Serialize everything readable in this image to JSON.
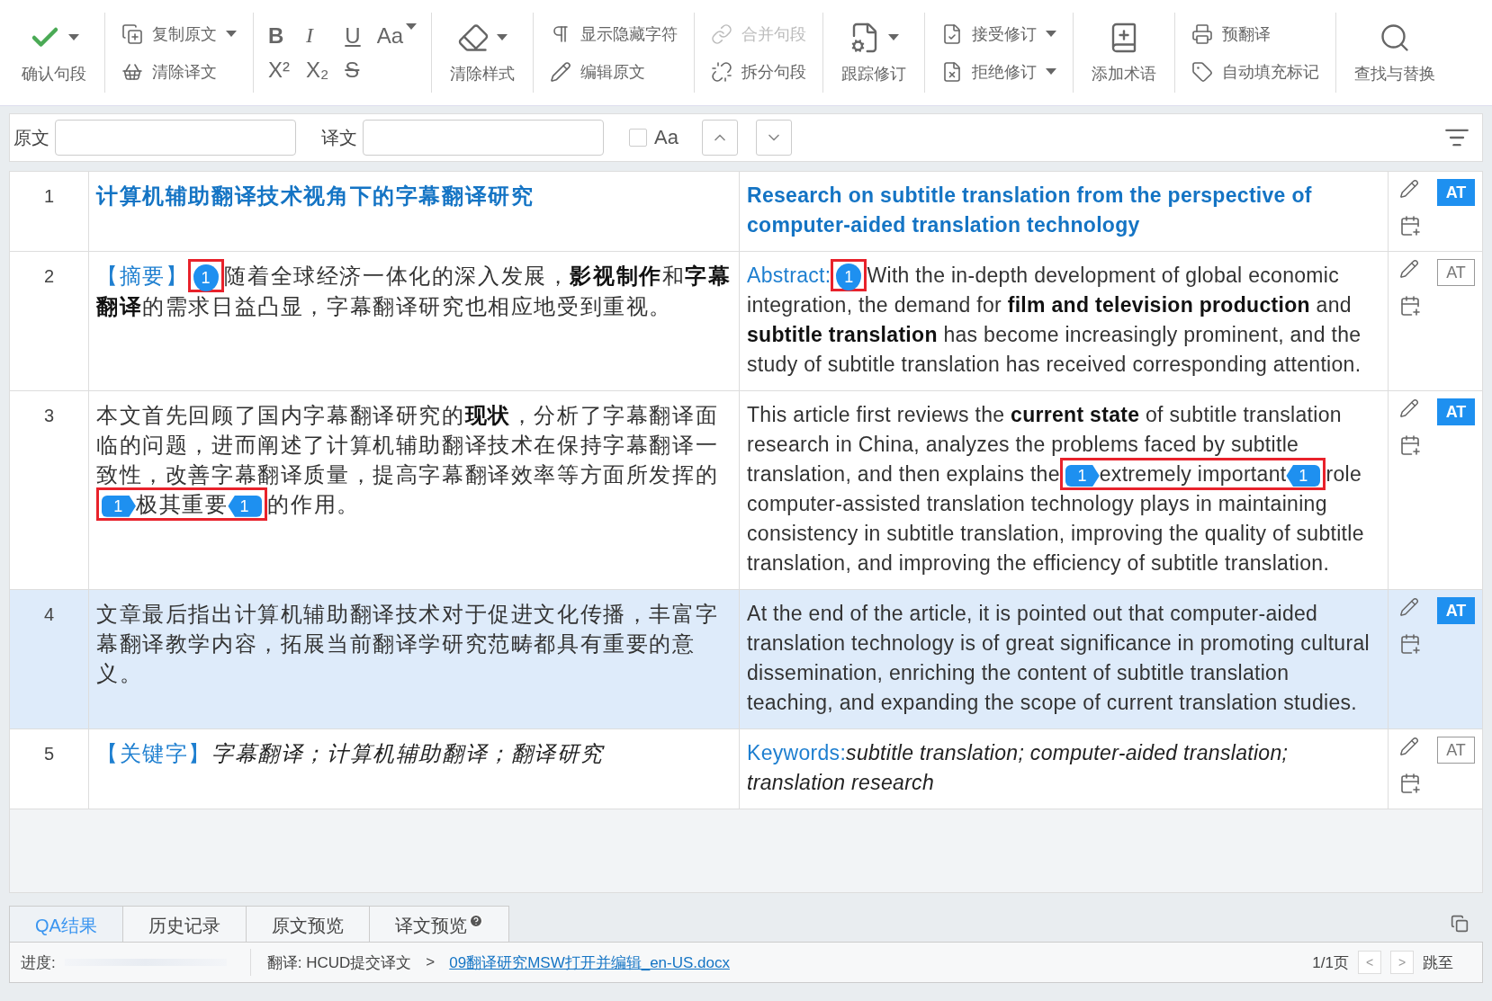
{
  "toolbar": {
    "groups": [
      {
        "kind": "large",
        "items": [
          {
            "label": "确认句段",
            "caret": true,
            "disabled": false
          }
        ]
      },
      {
        "kind": "stack",
        "items": [
          {
            "label": "复制原文",
            "caret": true,
            "disabled": false
          },
          {
            "label": "清除译文",
            "caret": false,
            "disabled": false
          }
        ]
      },
      {
        "kind": "format",
        "items": [
          {
            "kind": "bold",
            "glyph": "B",
            "caret": false
          },
          {
            "kind": "italic",
            "glyph": "I",
            "caret": false
          },
          {
            "kind": "underline",
            "glyph": "U",
            "caret": false
          },
          {
            "kind": "case",
            "glyph": "Aa",
            "caret": true
          },
          {
            "kind": "plain",
            "glyph": "X²",
            "caret": false
          },
          {
            "kind": "plain",
            "glyph": "X₂",
            "caret": false
          },
          {
            "kind": "strike",
            "glyph": "S",
            "caret": false
          }
        ]
      },
      {
        "kind": "large",
        "items": [
          {
            "label": "清除样式",
            "caret": true,
            "disabled": false
          }
        ]
      },
      {
        "kind": "stack",
        "items": [
          {
            "label": "显示隐藏字符",
            "caret": false,
            "disabled": false
          },
          {
            "label": "编辑原文",
            "caret": false,
            "disabled": false
          }
        ]
      },
      {
        "kind": "stack",
        "items": [
          {
            "label": "合并句段",
            "caret": false,
            "disabled": true
          },
          {
            "label": "拆分句段",
            "caret": false,
            "disabled": false
          }
        ]
      },
      {
        "kind": "large",
        "items": [
          {
            "label": "跟踪修订",
            "caret": true,
            "disabled": false
          }
        ]
      },
      {
        "kind": "stack",
        "items": [
          {
            "label": "接受修订",
            "caret": true,
            "disabled": false
          },
          {
            "label": "拒绝修订",
            "caret": true,
            "disabled": false
          }
        ]
      },
      {
        "kind": "large",
        "items": [
          {
            "label": "添加术语",
            "caret": false,
            "disabled": false
          }
        ]
      },
      {
        "kind": "stack",
        "items": [
          {
            "label": "预翻译",
            "caret": false,
            "disabled": false
          },
          {
            "label": "自动填充标记",
            "caret": false,
            "disabled": false
          }
        ]
      },
      {
        "kind": "large",
        "items": [
          {
            "label": "查找与替换",
            "caret": false,
            "disabled": false
          }
        ]
      }
    ]
  },
  "filter": {
    "source_label": "原文",
    "target_label": "译文",
    "case_label": "Aa",
    "case_checked": false
  },
  "segments": [
    {
      "number": "1",
      "selected": false,
      "at_on": true,
      "at_label": "AT",
      "source": [
        {
          "kind": "title",
          "text": "计算机辅助翻译技术视角下的字幕翻译研究"
        }
      ],
      "target": [
        {
          "kind": "title",
          "text": "Research on subtitle translation from the perspective of computer-aided translation technology"
        }
      ]
    },
    {
      "number": "2",
      "selected": false,
      "at_on": false,
      "at_label": "AT",
      "source": [
        {
          "kind": "label",
          "text": "【摘要】"
        },
        {
          "kind": "mark",
          "parts": [
            {
              "kind": "tag_single",
              "text": "1"
            }
          ]
        },
        {
          "kind": "text",
          "text": "随着全球经济一体化的深入发展，**影视制作**和**字幕翻译**的需求日益凸显，字幕翻译研究也相应地受到重视。"
        }
      ],
      "target": [
        {
          "kind": "label",
          "text": "Abstract:"
        },
        {
          "kind": "mark",
          "parts": [
            {
              "kind": "tag_single",
              "text": "1"
            }
          ]
        },
        {
          "kind": "text",
          "text": "With the in-depth development of global economic integration, the demand for **film and television production** and **subtitle translation** has become increasingly prominent, and the study of subtitle translation has received corresponding attention."
        }
      ]
    },
    {
      "number": "3",
      "selected": false,
      "at_on": true,
      "at_label": "AT",
      "source": [
        {
          "kind": "text",
          "text": "本文首先回顾了国内字幕翻译研究的**现状**，分析了字幕翻译面临的问题，进而阐述了计算机辅助翻译技术在保持字幕翻译一致性，改善字幕翻译质量，提高字幕翻译效率等方面所发挥的"
        },
        {
          "kind": "mark",
          "parts": [
            {
              "kind": "tag_open",
              "text": "1"
            },
            {
              "kind": "text",
              "text": "极其重要"
            },
            {
              "kind": "tag_close",
              "text": "1"
            }
          ]
        },
        {
          "kind": "text",
          "text": "的作用。"
        }
      ],
      "target": [
        {
          "kind": "text",
          "text": "This article first reviews the **current state** of subtitle translation research in China, analyzes the problems faced by subtitle translation, and then explains the"
        },
        {
          "kind": "mark",
          "parts": [
            {
              "kind": "tag_open",
              "text": "1"
            },
            {
              "kind": "text",
              "text": "extremely important"
            },
            {
              "kind": "tag_close",
              "text": "1"
            }
          ]
        },
        {
          "kind": "text",
          "text": "role computer-assisted translation technology plays in maintaining consistency in subtitle translation, improving the quality of subtitle translation, and improving the efficiency of subtitle translation."
        }
      ]
    },
    {
      "number": "4",
      "selected": true,
      "at_on": true,
      "at_label": "AT",
      "source": [
        {
          "kind": "text",
          "text": "文章最后指出计算机辅助翻译技术对于促进文化传播，丰富字幕翻译教学内容，拓展当前翻译学研究范畴都具有重要的意义。"
        }
      ],
      "target": [
        {
          "kind": "text",
          "text": "At the end of the article, it is pointed out that computer-aided translation technology is of great significance in promoting cultural dissemination, enriching the content of subtitle translation teaching, and expanding the scope of current translation studies."
        }
      ]
    },
    {
      "number": "5",
      "selected": false,
      "at_on": false,
      "at_label": "AT",
      "source": [
        {
          "kind": "label",
          "text": "【关键字】"
        },
        {
          "kind": "italic",
          "text": "字幕翻译；计算机辅助翻译；翻译研究"
        }
      ],
      "target": [
        {
          "kind": "label",
          "text": "Keywords:"
        },
        {
          "kind": "italic",
          "text": "subtitle translation; computer-aided translation; translation research"
        }
      ]
    }
  ],
  "bottom_tabs": [
    {
      "label": "QA结果",
      "selected": true,
      "help": false
    },
    {
      "label": "历史记录",
      "selected": false,
      "help": false
    },
    {
      "label": "原文预览",
      "selected": false,
      "help": false
    },
    {
      "label": "译文预览",
      "selected": false,
      "help": true
    }
  ],
  "status_bar": {
    "progress_label": "进度:",
    "level": 0,
    "path": "翻译: HCUD提交译文",
    "separator": ">",
    "file_link": "09翻译研究MSW打开并编辑_en-US.docx",
    "page": "1/1页",
    "prev": "<",
    "next": ">",
    "jump": "跳至"
  }
}
